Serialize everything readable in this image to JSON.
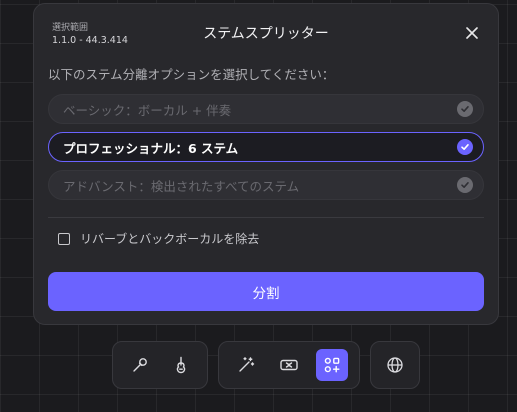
{
  "dialog": {
    "range_label": "選択範囲",
    "range_value": "1.1.0 - 44.3.414",
    "title": "ステムスプリッター",
    "instruction": "以下のステム分離オプションを選択してください：",
    "options": [
      {
        "label": "ベーシック：ボーカル + 伴奏",
        "selected": false
      },
      {
        "label": "プロフェッショナル：6 ステム",
        "selected": true
      },
      {
        "label": "アドバンスト：検出されたすべてのステム",
        "selected": false
      }
    ],
    "checkbox_label": "リバーブとバックボーカルを除去",
    "checkbox_checked": false,
    "split_button": "分割"
  },
  "toolbar": {
    "groups": [
      [
        "microphone-icon",
        "guitar-icon"
      ],
      [
        "magic-wand-icon",
        "loop-arrows-icon",
        "stem-splitter-icon"
      ],
      [
        "globe-icon"
      ]
    ],
    "active_tool": "stem-splitter-icon"
  },
  "colors": {
    "accent": "#6b63ff",
    "panel": "#28282c",
    "background": "#1b1b1e"
  }
}
